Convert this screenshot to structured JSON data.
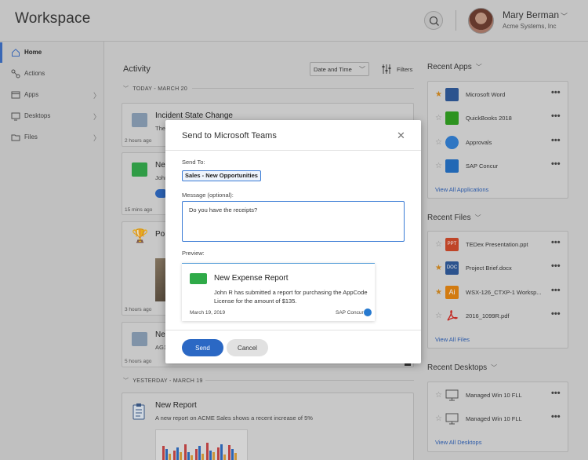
{
  "header": {
    "app_title": "Workspace",
    "user_name": "Mary Berman",
    "user_org": "Acme Systems, Inc"
  },
  "sidebar": {
    "items": [
      {
        "label": "Home",
        "icon": "home-icon"
      },
      {
        "label": "Actions",
        "icon": "actions-icon"
      },
      {
        "label": "Apps",
        "icon": "apps-icon"
      },
      {
        "label": "Desktops",
        "icon": "desktop-icon"
      },
      {
        "label": "Files",
        "icon": "folder-icon"
      }
    ]
  },
  "activity": {
    "title": "Activity",
    "sort_value": "Date and Time",
    "filters_label": "Filters",
    "groups": [
      {
        "label": "TODAY - MARCH 20"
      },
      {
        "label": "YESTERDAY - MARCH 19"
      }
    ],
    "cards": [
      {
        "title": "Incident State Change",
        "desc": "The",
        "time": "2 hours ago"
      },
      {
        "title": "Ne",
        "desc": "John",
        "time": "15 mins ago"
      },
      {
        "title": "Po",
        "desc": "",
        "time": "3 hours ago"
      },
      {
        "title": "Ne",
        "desc": "AG1",
        "time": "5 hours ago"
      },
      {
        "title": "New Report",
        "desc": "A new report on ACME Sales shows a recent increase of 5%",
        "time": ""
      }
    ]
  },
  "recent_apps": {
    "title": "Recent Apps",
    "items": [
      {
        "label": "Microsoft Word",
        "starred": true,
        "icon": "word-icon"
      },
      {
        "label": "QuickBooks 2018",
        "starred": false,
        "icon": "quickbooks-icon"
      },
      {
        "label": "Approvals",
        "starred": false,
        "icon": "approvals-icon"
      },
      {
        "label": "SAP Concur",
        "starred": false,
        "icon": "concur-icon"
      }
    ],
    "link": "View All Applications"
  },
  "recent_files": {
    "title": "Recent Files",
    "items": [
      {
        "label": "TEDex Presentation.ppt",
        "starred": false,
        "icon": "ppt-icon",
        "badge": "PPT"
      },
      {
        "label": "Project Brief.docx",
        "starred": true,
        "icon": "doc-icon",
        "badge": "DOC"
      },
      {
        "label": "WSX-126_CTXP-1 Worksp...",
        "starred": true,
        "icon": "illustrator-icon",
        "badge": "Ai"
      },
      {
        "label": "2016_1099R.pdf",
        "starred": false,
        "icon": "pdf-icon",
        "badge": ""
      }
    ],
    "link": "View All Files"
  },
  "recent_desktops": {
    "title": "Recent Desktops",
    "items": [
      {
        "label": "Managed Win 10 FLL",
        "starred": false
      },
      {
        "label": "Managed Win 10 FLL",
        "starred": false
      }
    ],
    "link": "View All Desktops"
  },
  "modal": {
    "title": "Send to Microsoft Teams",
    "send_to_label": "Send To:",
    "send_to_value": "Sales - New Opportunities",
    "message_label": "Message (optional):",
    "message_value": "Do you have the receipts?",
    "preview_label": "Preview:",
    "preview": {
      "title": "New Expense Report",
      "body": "John R has submitted a report for purchasing the AppCode License for the amount of $135.",
      "date": "March 19, 2019",
      "source": "SAP Concur"
    },
    "send_label": "Send",
    "cancel_label": "Cancel"
  }
}
